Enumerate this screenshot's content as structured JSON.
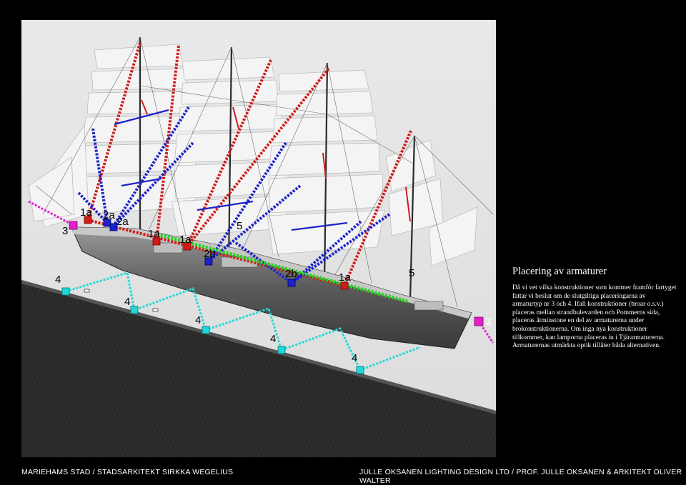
{
  "side_panel": {
    "title": "Placering av armaturer",
    "body": "Då vi vet vilka konstruktioner som kommer framför fartyget fattar vi beslut om de slutgiltiga placeringarna av armaturtyp nr 3 och 4. Ifall konstruktioner (broar o.s.v.) placeras mellan strandbulevarden och Pommerns sida, placeras åtminstone en del av armaturerna under brokonstruktionerna. Om inga nya konstruktioner tillkommer, kan lamporna placeras in i Tjärarmaturerna. Armaturernas utmärkta optik tillåter båda alternativen."
  },
  "footer": {
    "left": "MARIEHAMS STAD / STADSARKITEKT SIRKKA WEGELIUS",
    "right": "JULLE OKSANEN LIGHTING DESIGN LTD / PROF. JULLE OKSANEN & ARKITEKT OLIVER WALTER"
  },
  "labels": {
    "l1": "3",
    "l2": "1a",
    "l3": "2a",
    "l4": "2a",
    "l5": "1a",
    "l6": "1a",
    "l7": "5",
    "l8": "2b",
    "l9": "2b",
    "l10": "1a",
    "l11": "5",
    "l12": "3",
    "l13": "4",
    "l14": "4",
    "l15": "4",
    "l16": "4",
    "l17": "4"
  },
  "colors": {
    "red": "#d11a1a",
    "blue": "#1d23c9",
    "green": "#22d21c",
    "cyan": "#22d8d8",
    "magenta": "#e21fc9",
    "background": "#000000",
    "photo": "#e6e6e6"
  }
}
